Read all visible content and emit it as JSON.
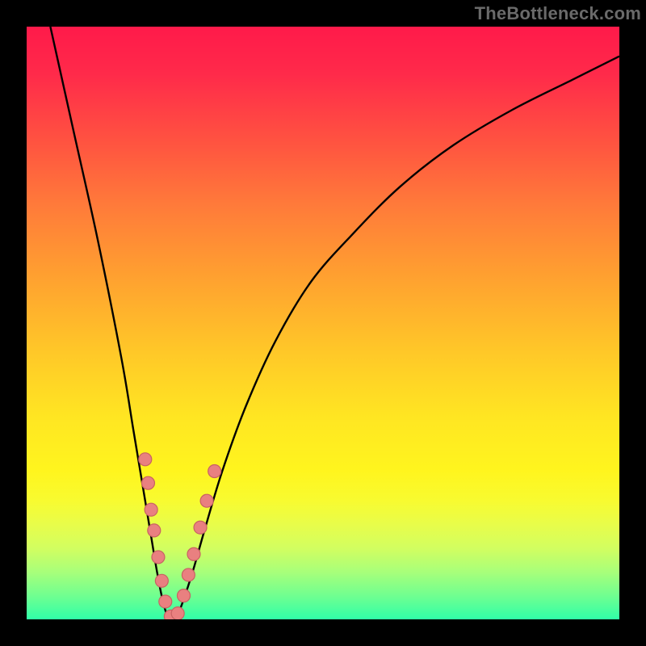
{
  "watermark": "TheBottleneck.com",
  "chart_data": {
    "type": "line",
    "title": "",
    "xlabel": "",
    "ylabel": "",
    "xlim": [
      0,
      100
    ],
    "ylim": [
      0,
      100
    ],
    "grid": false,
    "series": [
      {
        "name": "curve",
        "x": [
          4,
          8,
          12,
          16,
          18,
          20,
          21,
          22,
          23,
          24,
          25,
          26,
          28,
          30,
          33,
          37,
          42,
          48,
          55,
          63,
          72,
          82,
          92,
          100
        ],
        "y": [
          100,
          82,
          64,
          44,
          32,
          20,
          14,
          8,
          3,
          0,
          0,
          2,
          8,
          15,
          25,
          36,
          47,
          57,
          65,
          73,
          80,
          86,
          91,
          95
        ]
      }
    ],
    "markers": [
      {
        "x": 20.0,
        "y": 27.0
      },
      {
        "x": 20.5,
        "y": 23.0
      },
      {
        "x": 21.0,
        "y": 18.5
      },
      {
        "x": 21.5,
        "y": 15.0
      },
      {
        "x": 22.2,
        "y": 10.5
      },
      {
        "x": 22.8,
        "y": 6.5
      },
      {
        "x": 23.4,
        "y": 3.0
      },
      {
        "x": 24.3,
        "y": 0.5
      },
      {
        "x": 25.5,
        "y": 1.0
      },
      {
        "x": 26.5,
        "y": 4.0
      },
      {
        "x": 27.3,
        "y": 7.5
      },
      {
        "x": 28.2,
        "y": 11.0
      },
      {
        "x": 29.3,
        "y": 15.5
      },
      {
        "x": 30.4,
        "y": 20.0
      },
      {
        "x": 31.7,
        "y": 25.0
      }
    ],
    "marker_style": {
      "fill": "#e98080",
      "stroke": "#c86262",
      "r": 8
    }
  }
}
